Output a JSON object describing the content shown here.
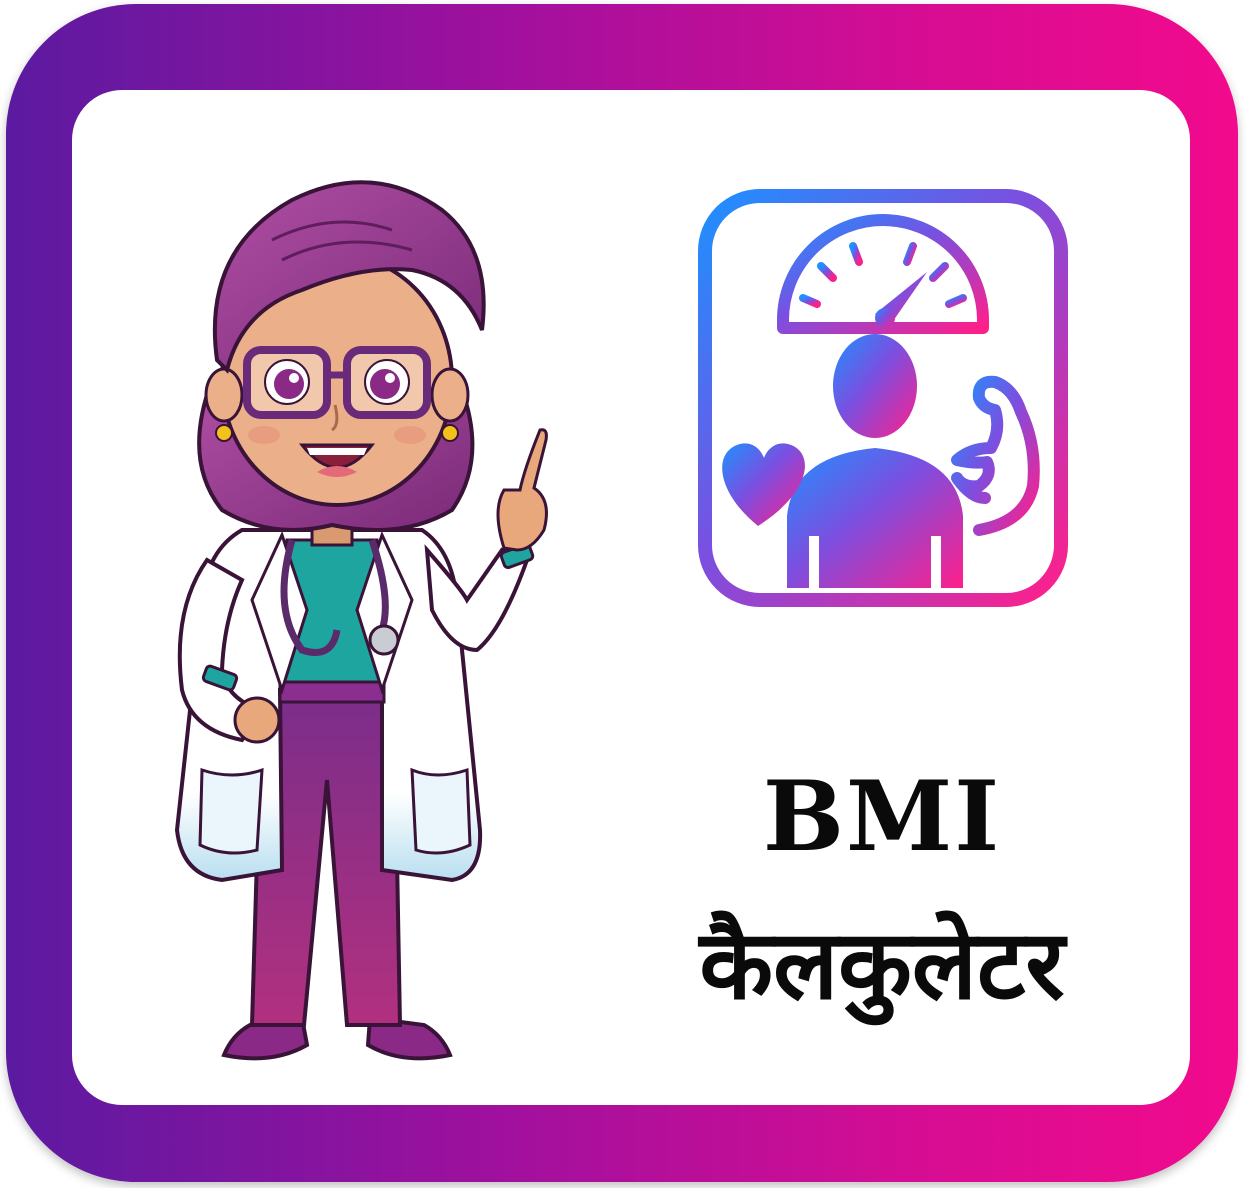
{
  "card": {
    "title_line1": "BMI",
    "title_line2": "कैलकुलेटर"
  },
  "icons": {
    "app_icon": "bmi-scale-person-icon",
    "heart": "heart-icon",
    "gauge": "scale-gauge-icon",
    "muscle": "flexed-arm-icon",
    "person": "person-silhouette-icon"
  },
  "colors": {
    "frame_start": "#5b1aa0",
    "frame_end": "#f20a8c",
    "icon_gradient_start": "#1e90ff",
    "icon_gradient_mid": "#7b4fe0",
    "icon_gradient_end": "#ff1f8a",
    "card_bg": "#ffffff",
    "hair": "#9b3a8e",
    "teal_shirt": "#1fa5a0"
  }
}
